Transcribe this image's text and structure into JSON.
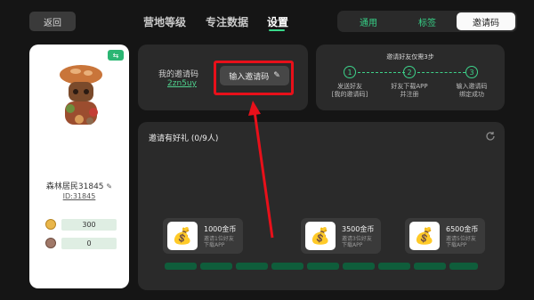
{
  "topbar": {
    "back_label": "返回",
    "tabs": [
      {
        "label": "营地等级"
      },
      {
        "label": "专注数据"
      },
      {
        "label": "设置"
      }
    ],
    "segments": [
      {
        "label": "通用"
      },
      {
        "label": "标签"
      },
      {
        "label": "邀请码"
      }
    ]
  },
  "profile": {
    "name": "森林居民31845",
    "id_text": "ID:31845",
    "coins": "300",
    "gems": "0"
  },
  "invite": {
    "label": "我的邀请码",
    "code": "2zn5uy",
    "enter_button": "输入邀请码"
  },
  "steps": {
    "title": "邀请好友仅需3步",
    "items": [
      {
        "num": "1",
        "text_1": "发送好友",
        "text_2": "[我的邀请码]"
      },
      {
        "num": "2",
        "text_1": "好友下载APP",
        "text_2": "并注册"
      },
      {
        "num": "3",
        "text_1": "输入邀请码",
        "text_2": "绑定成功"
      }
    ]
  },
  "rewards": {
    "title": "邀请有好礼 (0/9人)",
    "progress": 0,
    "cards": [
      {
        "amount": "1000金币",
        "desc_1": "邀请1位好友",
        "desc_2": "下载APP"
      },
      {
        "amount": "3500金币",
        "desc_1": "邀请3位好友",
        "desc_2": "下载APP"
      },
      {
        "amount": "6500金币",
        "desc_1": "邀请5位好友",
        "desc_2": "下载APP"
      }
    ]
  },
  "colors": {
    "accent": "#39d98a",
    "annotation": "#e8101a"
  }
}
